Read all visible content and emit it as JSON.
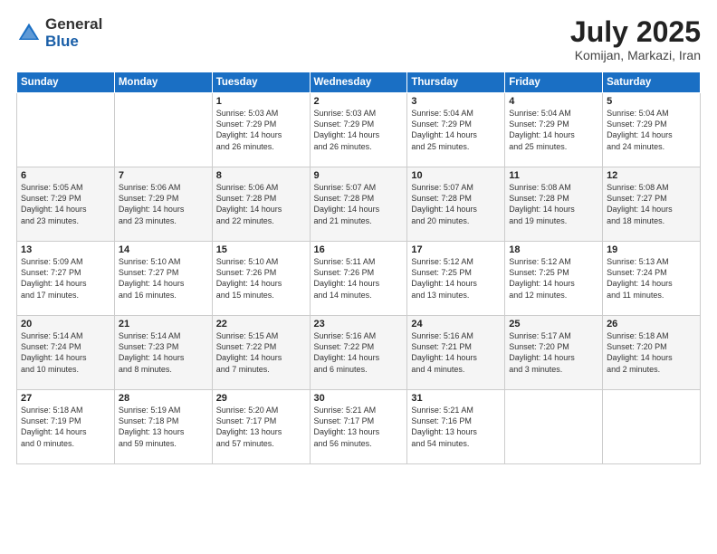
{
  "logo": {
    "general": "General",
    "blue": "Blue"
  },
  "title": "July 2025",
  "location": "Komijan, Markazi, Iran",
  "days_of_week": [
    "Sunday",
    "Monday",
    "Tuesday",
    "Wednesday",
    "Thursday",
    "Friday",
    "Saturday"
  ],
  "weeks": [
    [
      {
        "day": "",
        "info": ""
      },
      {
        "day": "",
        "info": ""
      },
      {
        "day": "1",
        "info": "Sunrise: 5:03 AM\nSunset: 7:29 PM\nDaylight: 14 hours\nand 26 minutes."
      },
      {
        "day": "2",
        "info": "Sunrise: 5:03 AM\nSunset: 7:29 PM\nDaylight: 14 hours\nand 26 minutes."
      },
      {
        "day": "3",
        "info": "Sunrise: 5:04 AM\nSunset: 7:29 PM\nDaylight: 14 hours\nand 25 minutes."
      },
      {
        "day": "4",
        "info": "Sunrise: 5:04 AM\nSunset: 7:29 PM\nDaylight: 14 hours\nand 25 minutes."
      },
      {
        "day": "5",
        "info": "Sunrise: 5:04 AM\nSunset: 7:29 PM\nDaylight: 14 hours\nand 24 minutes."
      }
    ],
    [
      {
        "day": "6",
        "info": "Sunrise: 5:05 AM\nSunset: 7:29 PM\nDaylight: 14 hours\nand 23 minutes."
      },
      {
        "day": "7",
        "info": "Sunrise: 5:06 AM\nSunset: 7:29 PM\nDaylight: 14 hours\nand 23 minutes."
      },
      {
        "day": "8",
        "info": "Sunrise: 5:06 AM\nSunset: 7:28 PM\nDaylight: 14 hours\nand 22 minutes."
      },
      {
        "day": "9",
        "info": "Sunrise: 5:07 AM\nSunset: 7:28 PM\nDaylight: 14 hours\nand 21 minutes."
      },
      {
        "day": "10",
        "info": "Sunrise: 5:07 AM\nSunset: 7:28 PM\nDaylight: 14 hours\nand 20 minutes."
      },
      {
        "day": "11",
        "info": "Sunrise: 5:08 AM\nSunset: 7:28 PM\nDaylight: 14 hours\nand 19 minutes."
      },
      {
        "day": "12",
        "info": "Sunrise: 5:08 AM\nSunset: 7:27 PM\nDaylight: 14 hours\nand 18 minutes."
      }
    ],
    [
      {
        "day": "13",
        "info": "Sunrise: 5:09 AM\nSunset: 7:27 PM\nDaylight: 14 hours\nand 17 minutes."
      },
      {
        "day": "14",
        "info": "Sunrise: 5:10 AM\nSunset: 7:27 PM\nDaylight: 14 hours\nand 16 minutes."
      },
      {
        "day": "15",
        "info": "Sunrise: 5:10 AM\nSunset: 7:26 PM\nDaylight: 14 hours\nand 15 minutes."
      },
      {
        "day": "16",
        "info": "Sunrise: 5:11 AM\nSunset: 7:26 PM\nDaylight: 14 hours\nand 14 minutes."
      },
      {
        "day": "17",
        "info": "Sunrise: 5:12 AM\nSunset: 7:25 PM\nDaylight: 14 hours\nand 13 minutes."
      },
      {
        "day": "18",
        "info": "Sunrise: 5:12 AM\nSunset: 7:25 PM\nDaylight: 14 hours\nand 12 minutes."
      },
      {
        "day": "19",
        "info": "Sunrise: 5:13 AM\nSunset: 7:24 PM\nDaylight: 14 hours\nand 11 minutes."
      }
    ],
    [
      {
        "day": "20",
        "info": "Sunrise: 5:14 AM\nSunset: 7:24 PM\nDaylight: 14 hours\nand 10 minutes."
      },
      {
        "day": "21",
        "info": "Sunrise: 5:14 AM\nSunset: 7:23 PM\nDaylight: 14 hours\nand 8 minutes."
      },
      {
        "day": "22",
        "info": "Sunrise: 5:15 AM\nSunset: 7:22 PM\nDaylight: 14 hours\nand 7 minutes."
      },
      {
        "day": "23",
        "info": "Sunrise: 5:16 AM\nSunset: 7:22 PM\nDaylight: 14 hours\nand 6 minutes."
      },
      {
        "day": "24",
        "info": "Sunrise: 5:16 AM\nSunset: 7:21 PM\nDaylight: 14 hours\nand 4 minutes."
      },
      {
        "day": "25",
        "info": "Sunrise: 5:17 AM\nSunset: 7:20 PM\nDaylight: 14 hours\nand 3 minutes."
      },
      {
        "day": "26",
        "info": "Sunrise: 5:18 AM\nSunset: 7:20 PM\nDaylight: 14 hours\nand 2 minutes."
      }
    ],
    [
      {
        "day": "27",
        "info": "Sunrise: 5:18 AM\nSunset: 7:19 PM\nDaylight: 14 hours\nand 0 minutes."
      },
      {
        "day": "28",
        "info": "Sunrise: 5:19 AM\nSunset: 7:18 PM\nDaylight: 13 hours\nand 59 minutes."
      },
      {
        "day": "29",
        "info": "Sunrise: 5:20 AM\nSunset: 7:17 PM\nDaylight: 13 hours\nand 57 minutes."
      },
      {
        "day": "30",
        "info": "Sunrise: 5:21 AM\nSunset: 7:17 PM\nDaylight: 13 hours\nand 56 minutes."
      },
      {
        "day": "31",
        "info": "Sunrise: 5:21 AM\nSunset: 7:16 PM\nDaylight: 13 hours\nand 54 minutes."
      },
      {
        "day": "",
        "info": ""
      },
      {
        "day": "",
        "info": ""
      }
    ]
  ]
}
